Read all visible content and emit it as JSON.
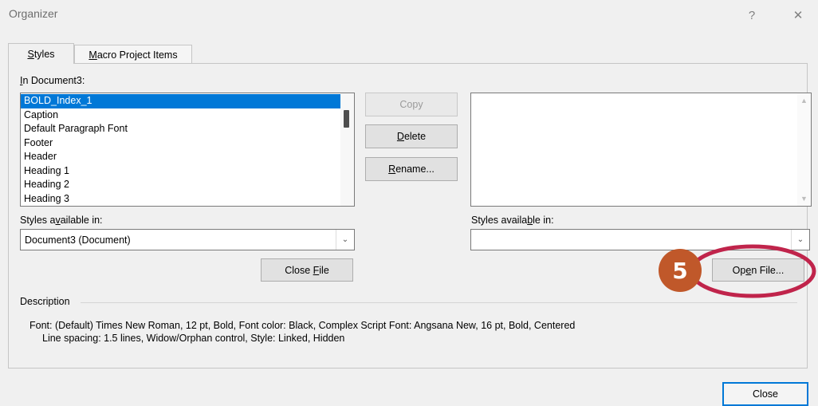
{
  "window": {
    "title": "Organizer",
    "help_glyph": "?",
    "close_glyph": "✕"
  },
  "tabs": [
    {
      "label": "Styles",
      "mnemonic": "S",
      "rest": "tyles",
      "active": true
    },
    {
      "label": "Macro Project Items",
      "mnemonic": "M",
      "rest": "acro Project Items",
      "active": false
    }
  ],
  "left": {
    "list_label_mn": "I",
    "list_label_rest": "n Document3:",
    "items": [
      "BOLD_Index_1",
      "Caption",
      "Default Paragraph Font",
      "Footer",
      "Header",
      "Heading 1",
      "Heading 2",
      "Heading 3"
    ],
    "selected_index": 0,
    "available_pre": "Styles a",
    "available_mn": "v",
    "available_post": "ailable in:",
    "combo_value": "Document3 (Document)",
    "close_file_pre": "Close ",
    "close_file_mn": "F",
    "close_file_post": "ile"
  },
  "middle": {
    "copy_label": "Copy",
    "delete_mn": "D",
    "delete_rest": "elete",
    "rename_mn": "R",
    "rename_rest": "ename..."
  },
  "right": {
    "available_pre": "Styles availa",
    "available_mn": "b",
    "available_post": "le in:",
    "combo_value": "",
    "open_file_pre": "Op",
    "open_file_mn": "e",
    "open_file_post": "n File..."
  },
  "description": {
    "label": "Description",
    "line1": "Font: (Default) Times New Roman, 12 pt, Bold, Font color: Black, Complex Script Font: Angsana New, 16 pt, Bold, Centered",
    "line2": "Line spacing:  1.5 lines, Widow/Orphan control, Style: Linked, Hidden"
  },
  "footer": {
    "close_label": "Close"
  },
  "annotation": {
    "step_number": "5",
    "badge_color": "#c0582a",
    "ring_color": "#c0244b"
  },
  "colors": {
    "selection": "#0078d7",
    "default_button_border": "#0078d7"
  }
}
